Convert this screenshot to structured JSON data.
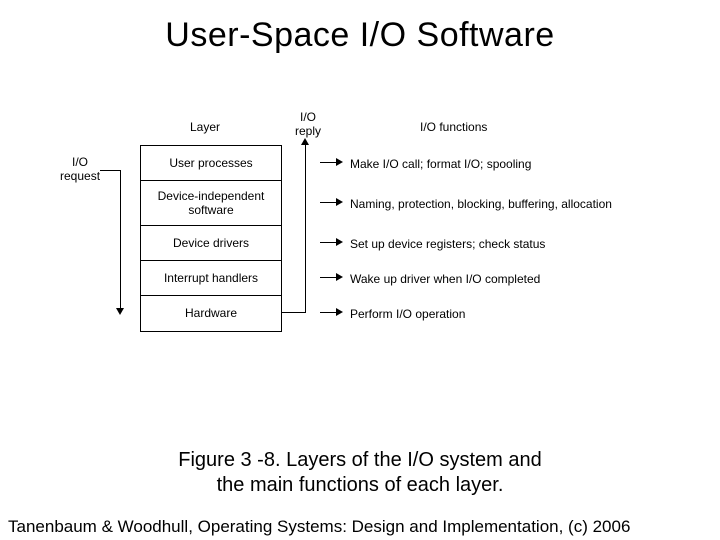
{
  "title": "User-Space I/O Software",
  "headers": {
    "layer": "Layer",
    "reply": "I/O\nreply",
    "functions": "I/O functions",
    "request": "I/O\nrequest"
  },
  "layers": [
    {
      "name": "User processes",
      "func": "Make I/O call; format I/O; spooling"
    },
    {
      "name": "Device-independent\nsoftware",
      "func": "Naming, protection, blocking, buffering, allocation"
    },
    {
      "name": "Device drivers",
      "func": "Set up device registers; check status"
    },
    {
      "name": "Interrupt handlers",
      "func": "Wake up driver when I/O completed"
    },
    {
      "name": "Hardware",
      "func": "Perform I/O operation"
    }
  ],
  "caption_line1": "Figure 3 -8. Layers of the I/O system and",
  "caption_line2": "the main functions of each layer.",
  "credit": "Tanenbaum & Woodhull, Operating Systems: Design and Implementation, (c) 2006"
}
